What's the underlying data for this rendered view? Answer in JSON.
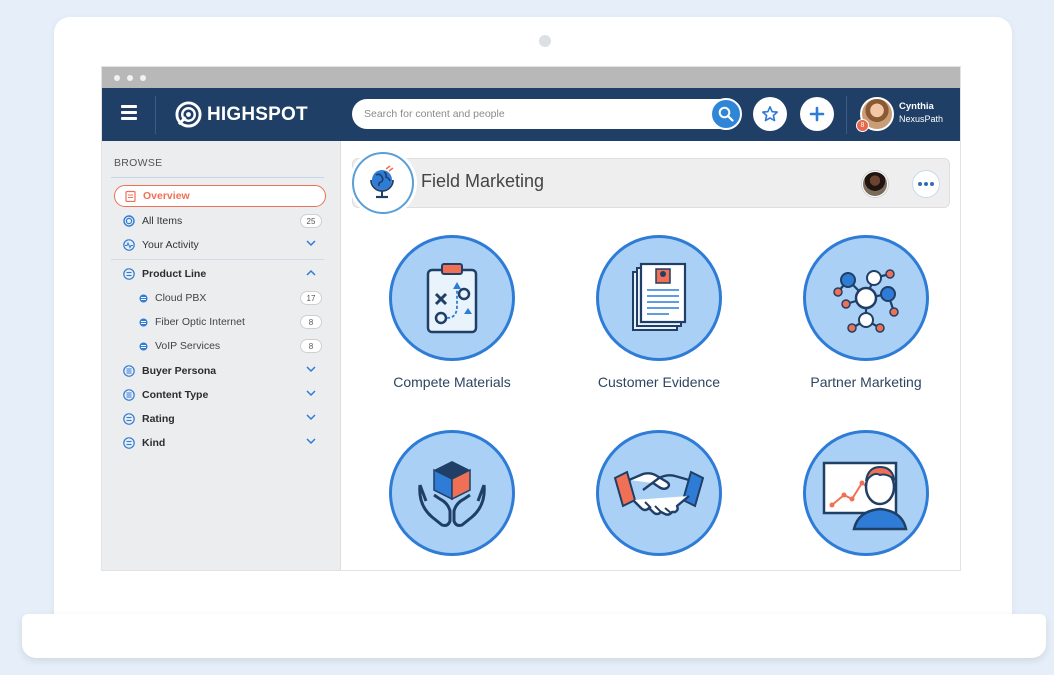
{
  "topbar": {
    "brand": "HIGHSPOT",
    "search_placeholder": "Search for content and people",
    "user_name": "Cynthia",
    "user_org": "NexusPath",
    "notification_count": "8"
  },
  "sidebar": {
    "heading": "BROWSE",
    "overview": "Overview",
    "all_items": {
      "label": "All Items",
      "count": "25"
    },
    "your_activity": "Your Activity",
    "product_line": "Product Line",
    "product_items": [
      {
        "label": "Cloud PBX",
        "count": "17"
      },
      {
        "label": "Fiber Optic Internet",
        "count": "8"
      },
      {
        "label": "VoIP Services",
        "count": "8"
      }
    ],
    "filters": [
      "Buyer Persona",
      "Content Type",
      "Rating",
      "Kind"
    ]
  },
  "main": {
    "spot_title": "Field Marketing",
    "tiles": [
      {
        "label": "Compete Materials",
        "icon": "clipboard-strategy-icon"
      },
      {
        "label": "Customer Evidence",
        "icon": "documents-icon"
      },
      {
        "label": "Partner Marketing",
        "icon": "network-icon"
      },
      {
        "label": "",
        "icon": "hands-cube-icon"
      },
      {
        "label": "",
        "icon": "handshake-icon"
      },
      {
        "label": "",
        "icon": "presenter-chart-icon"
      }
    ]
  },
  "colors": {
    "topbar": "#1f3f66",
    "accent": "#2e7cd6",
    "tile_fill": "#aad1f5",
    "active": "#f07055"
  }
}
